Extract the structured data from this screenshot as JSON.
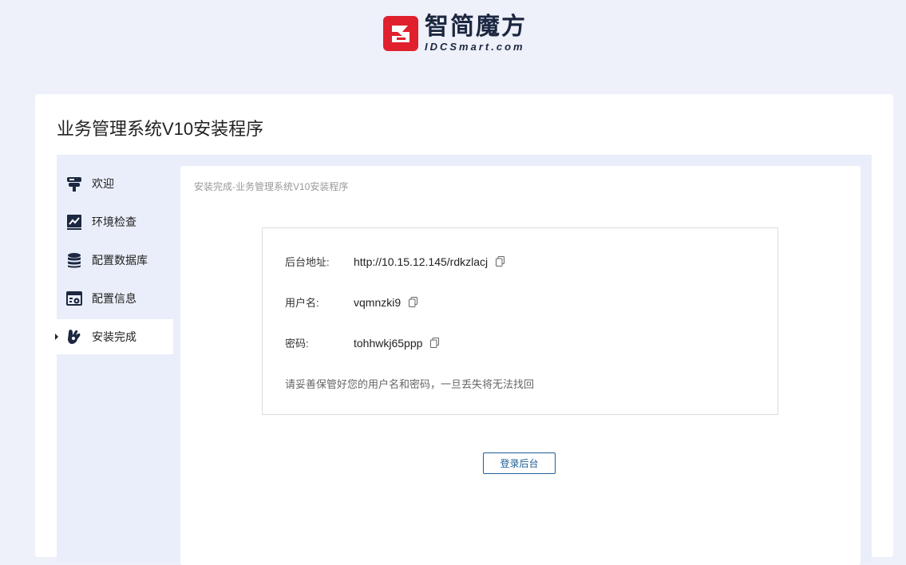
{
  "logo": {
    "cn": "智简魔方",
    "en": "IDCSmart.com",
    "brand_red": "#e0202c"
  },
  "page_title": "业务管理系统V10安装程序",
  "sidebar": {
    "items": [
      {
        "label": "欢迎",
        "icon": "welcome-sign-icon"
      },
      {
        "label": "环境检查",
        "icon": "chart-icon"
      },
      {
        "label": "配置数据库",
        "icon": "database-icon"
      },
      {
        "label": "配置信息",
        "icon": "settings-window-icon"
      },
      {
        "label": "安装完成",
        "icon": "ok-hand-icon",
        "active": true
      }
    ]
  },
  "breadcrumb": "安装完成-业务管理系统V10安装程序",
  "info": {
    "admin_url_label": "后台地址:",
    "admin_url": "http://10.15.12.145/rdkzlacj",
    "username_label": "用户名:",
    "username": "vqmnzki9",
    "password_label": "密码:",
    "password": "tohhwkj65ppp",
    "note": "请妥善保管好您的用户名和密码，一旦丢失将无法找回"
  },
  "login_button": "登录后台",
  "colors": {
    "accent": "#1f5d96",
    "background": "#eef0fa"
  }
}
